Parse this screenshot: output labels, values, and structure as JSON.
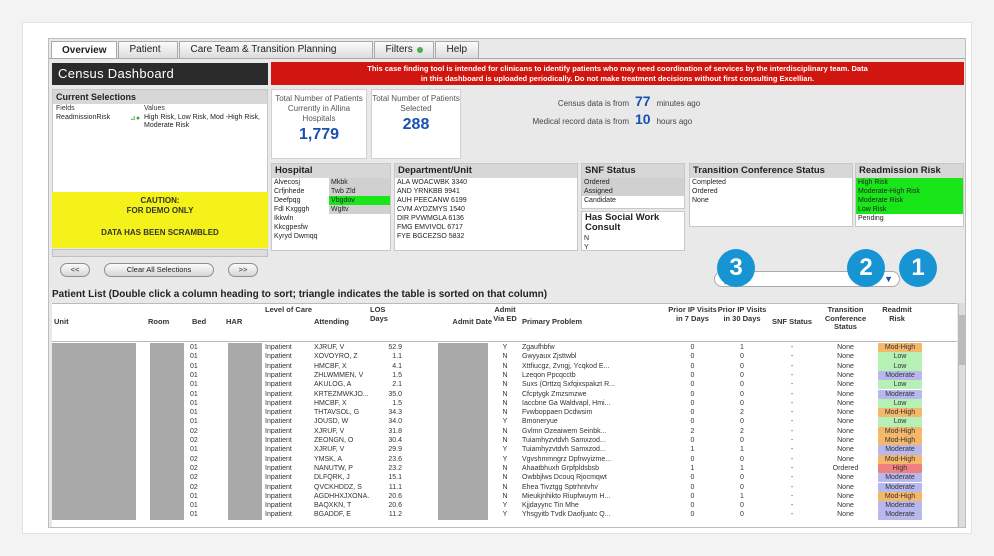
{
  "tabs": [
    {
      "label": "Overview",
      "active": true
    },
    {
      "label": "Patient",
      "active": false
    },
    {
      "label": "Care Team & Transition Planning",
      "active": false
    },
    {
      "label": "Filters",
      "active": false,
      "indicator": "green"
    },
    {
      "label": "Help",
      "active": false
    }
  ],
  "dashboard_title": "Census Dashboard",
  "banner": {
    "line1": "This case finding tool is intended for clinicans to identify patients who may need coordination of services by the interdisciplinary team. Data",
    "line2": "in this dashboard is uploaded periodically. Do not make treatment decisions without first consulting Excellian."
  },
  "current_selections": {
    "title": "Current Selections",
    "fields_label": "Fields",
    "values_label": "Values",
    "rows": [
      {
        "field": "ReadmissionRisk",
        "values": "High Risk, Low Risk, Mod -High Risk, Moderate Risk"
      }
    ]
  },
  "caution": {
    "line1": "CAUTION:",
    "line2": "FOR DEMO ONLY",
    "line3": "DATA HAS BEEN SCRAMBLED"
  },
  "buttons": {
    "back": "<<",
    "clear": "Clear All Selections",
    "forward": ">>"
  },
  "stats": {
    "total_patients_label": "Total Number of Patients Currently in Allina Hospitals",
    "total_patients_value": "1,779",
    "selected_label": "Total Number of Patients Selected",
    "selected_value": "288"
  },
  "census": {
    "census_label": "Census data is from",
    "census_value": "77",
    "census_unit": "minutes ago",
    "record_label": "Medical record data is from",
    "record_value": "10",
    "record_unit": "hours ago"
  },
  "hospital": {
    "title": "Hospital",
    "col1": [
      "Alvecosj",
      "Crfjnhede",
      "Deefpqg",
      "Fdl Kxgggh",
      "Ikkwln",
      "Kkcgpesfw",
      "Kyryd Dwmqq"
    ],
    "col2": [
      "Mkbk",
      "Twb Zld",
      "Vbgdov",
      "Wgltv"
    ],
    "col2_highlight": [
      "Vbgdov"
    ]
  },
  "department": {
    "title": "Department/Unit",
    "items": [
      "ALA WOACWBK 3340",
      "AND YRNKBB 9941",
      "AUH PEECANW 6199",
      "CVM AYDZMYS 1540",
      "DIR PVWMGLA 6136",
      "FMG EMVIVOL 6717",
      "FYE BGCEZSO 5832"
    ]
  },
  "snf_status": {
    "title": "SNF Status",
    "items": [
      "Ordered",
      "Assigned",
      "Candidate"
    ]
  },
  "social_work": {
    "title": "Has Social Work Consult",
    "items": [
      "N",
      "Y"
    ]
  },
  "transition_status": {
    "title": "Transition Conference Status",
    "items": [
      "Completed",
      "Ordered",
      "None"
    ]
  },
  "readmission_risk": {
    "title": "Readmission Risk",
    "items": [
      "High Risk",
      "Moderate-High Risk",
      "Moderate Risk",
      "Low Risk",
      "Pending"
    ]
  },
  "badges": [
    "3",
    "2",
    "1"
  ],
  "patient_list_title": "Patient List (Double click a column heading to sort; triangle indicates the table is sorted on that column)",
  "columns": [
    "Unit",
    "Room",
    "Bed",
    "HAR",
    "Level of Care",
    "Attending",
    "LOS Days",
    "Admit Date",
    "Admit Via ED",
    "Primary Problem",
    "Prior IP Visits in 7 Days",
    "Prior IP Visits in 30 Days",
    "SNF Status",
    "Transition Conference Status",
    "Readmit Risk"
  ],
  "risk_colors": {
    "Mod-High": "#f5b86a",
    "Low": "#b5f0b5",
    "Moderate": "#b8b8ee",
    "High": "#f08080"
  },
  "rows": [
    {
      "bed": "01",
      "loc": "Inpatient",
      "att": "XJRUF, V",
      "los": "52.9",
      "ed": "Y",
      "prob": "Zgaufhbfw",
      "p7": "0",
      "p30": "1",
      "snf": "-",
      "tcs": "None",
      "risk": "Mod-High"
    },
    {
      "bed": "01",
      "loc": "Inpatient",
      "att": "XOVOYRO, Z",
      "los": "1.1",
      "ed": "N",
      "prob": "Gwyyaux Zjsttwbl",
      "p7": "0",
      "p30": "0",
      "snf": "-",
      "tcs": "None",
      "risk": "Low"
    },
    {
      "bed": "01",
      "loc": "Inpatient",
      "att": "HMCBF, X",
      "los": "4.1",
      "ed": "N",
      "prob": "Xttfiucgz, Zvngj, Ycqkod E...",
      "p7": "0",
      "p30": "0",
      "snf": "-",
      "tcs": "None",
      "risk": "Low"
    },
    {
      "bed": "01",
      "loc": "Inpatient",
      "att": "ZHLWMMEN, V",
      "los": "1.5",
      "ed": "N",
      "prob": "Lzeqon Ppcqcctb",
      "p7": "0",
      "p30": "0",
      "snf": "-",
      "tcs": "None",
      "risk": "Moderate"
    },
    {
      "bed": "01",
      "loc": "Inpatient",
      "att": "AKULOG, A",
      "los": "2.1",
      "ed": "N",
      "prob": "Suxs (Orttzq Sxfqixspakzt R...",
      "p7": "0",
      "p30": "0",
      "snf": "-",
      "tcs": "None",
      "risk": "Low"
    },
    {
      "bed": "01",
      "loc": "Inpatient",
      "att": "KRTEZMWKJO...",
      "los": "35.0",
      "ed": "N",
      "prob": "Cfcptygk Zmzsmzwe",
      "p7": "0",
      "p30": "0",
      "snf": "-",
      "tcs": "None",
      "risk": "Moderate"
    },
    {
      "bed": "01",
      "loc": "Inpatient",
      "att": "HMCBF, X",
      "los": "1.5",
      "ed": "N",
      "prob": "Iaccbne Ga Waldvapl, Hmi...",
      "p7": "0",
      "p30": "0",
      "snf": "-",
      "tcs": "None",
      "risk": "Low"
    },
    {
      "bed": "01",
      "loc": "Inpatient",
      "att": "THTAVSOL, G",
      "los": "34.3",
      "ed": "N",
      "prob": "Fvwboppaen Dcdwsim",
      "p7": "0",
      "p30": "2",
      "snf": "-",
      "tcs": "None",
      "risk": "Mod-High"
    },
    {
      "bed": "01",
      "loc": "Inpatient",
      "att": "JOUSD, W",
      "los": "34.0",
      "ed": "Y",
      "prob": "Bmoneryue",
      "p7": "0",
      "p30": "0",
      "snf": "-",
      "tcs": "None",
      "risk": "Low"
    },
    {
      "bed": "02",
      "loc": "Inpatient",
      "att": "XJRUF, V",
      "los": "31.8",
      "ed": "N",
      "prob": "Gvlmn Ozeaiwem Seinbk...",
      "p7": "2",
      "p30": "2",
      "snf": "-",
      "tcs": "None",
      "risk": "Mod-High"
    },
    {
      "bed": "02",
      "loc": "Inpatient",
      "att": "ZEONGN, O",
      "los": "30.4",
      "ed": "N",
      "prob": "Tuiamhyzvtdvh Samxzod...",
      "p7": "0",
      "p30": "0",
      "snf": "-",
      "tcs": "None",
      "risk": "Mod-High"
    },
    {
      "bed": "01",
      "loc": "Inpatient",
      "att": "XJRUF, V",
      "los": "29.9",
      "ed": "Y",
      "prob": "Tuiamhyzvtdvh Samxzod...",
      "p7": "1",
      "p30": "1",
      "snf": "-",
      "tcs": "None",
      "risk": "Moderate"
    },
    {
      "bed": "02",
      "loc": "Inpatient",
      "att": "YMSK, A",
      "los": "23.6",
      "ed": "Y",
      "prob": "Vgvshmmngrz Dpfrwyizme...",
      "p7": "0",
      "p30": "0",
      "snf": "-",
      "tcs": "None",
      "risk": "Mod-High"
    },
    {
      "bed": "02",
      "loc": "Inpatient",
      "att": "NANUTW, P",
      "los": "23.2",
      "ed": "N",
      "prob": "Ahaatbhuxh Grpfpldsbsb",
      "p7": "1",
      "p30": "1",
      "snf": "-",
      "tcs": "Ordered",
      "risk": "High"
    },
    {
      "bed": "02",
      "loc": "Inpatient",
      "att": "DLFQRK, J",
      "los": "15.1",
      "ed": "N",
      "prob": "Owbbjlws Dcouq Rjocmqwt",
      "p7": "0",
      "p30": "0",
      "snf": "-",
      "tcs": "None",
      "risk": "Moderate"
    },
    {
      "bed": "02",
      "loc": "Inpatient",
      "att": "QVCKHDDZ, S",
      "los": "11.1",
      "ed": "N",
      "prob": "Ehea Tivztgg Sptrhntvhv",
      "p7": "0",
      "p30": "0",
      "snf": "-",
      "tcs": "None",
      "risk": "Moderate"
    },
    {
      "bed": "01",
      "loc": "Inpatient",
      "att": "AGDHHXJXONA...",
      "los": "20.6",
      "ed": "N",
      "prob": "Mieukjnhikto Riupfwuym H...",
      "p7": "0",
      "p30": "1",
      "snf": "-",
      "tcs": "None",
      "risk": "Mod-High"
    },
    {
      "bed": "01",
      "loc": "Inpatient",
      "att": "BAQXKN, T",
      "los": "20.6",
      "ed": "Y",
      "prob": "Kjjdayync Tin Mhe",
      "p7": "0",
      "p30": "0",
      "snf": "-",
      "tcs": "None",
      "risk": "Moderate"
    },
    {
      "bed": "01",
      "loc": "Inpatient",
      "att": "BGADDF, E",
      "los": "11.2",
      "ed": "Y",
      "prob": "Yhsgyitb Tvdk Daofjuatc Q...",
      "p7": "0",
      "p30": "0",
      "snf": "-",
      "tcs": "None",
      "risk": "Moderate"
    }
  ]
}
